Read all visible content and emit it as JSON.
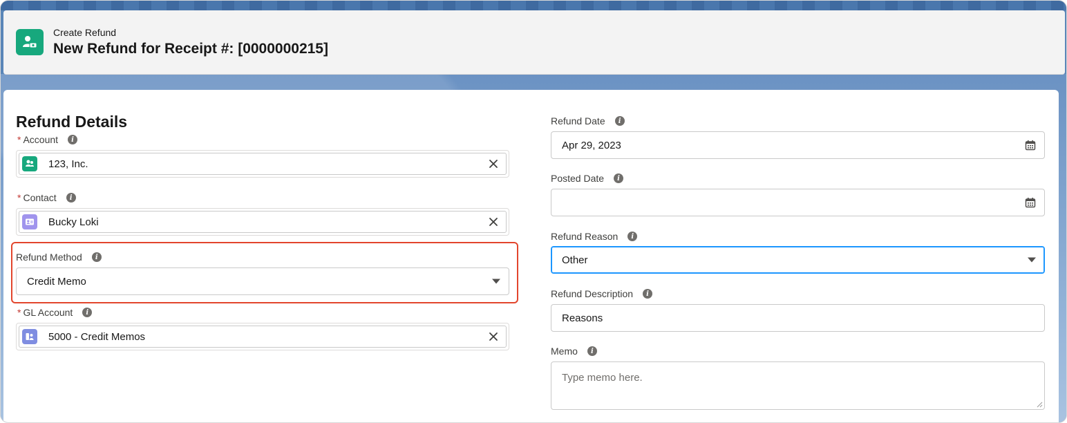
{
  "header": {
    "eyebrow": "Create Refund",
    "title": "New Refund for Receipt #: [0000000215]",
    "icon": "refund-user-icon",
    "accent": "#17a87d"
  },
  "section": {
    "title": "Refund Details"
  },
  "left": {
    "account": {
      "label": "Account",
      "required": true,
      "value": "123, Inc.",
      "icon": "account-icon",
      "icon_color": "#17a87d"
    },
    "contact": {
      "label": "Contact",
      "required": true,
      "value": "Bucky Loki",
      "icon": "contact-card-icon",
      "icon_color": "#a094ed"
    },
    "refund_method": {
      "label": "Refund Method",
      "required": false,
      "value": "Credit Memo"
    },
    "gl_account": {
      "label": "GL Account",
      "required": true,
      "value": "5000 - Credit Memos",
      "icon": "gl-account-icon",
      "icon_color": "#7f8de1"
    }
  },
  "right": {
    "refund_date": {
      "label": "Refund Date",
      "value": "Apr 29, 2023"
    },
    "posted_date": {
      "label": "Posted Date",
      "value": ""
    },
    "refund_reason": {
      "label": "Refund Reason",
      "value": "Other"
    },
    "refund_description": {
      "label": "Refund Description",
      "value": "Reasons"
    },
    "memo": {
      "label": "Memo",
      "placeholder": "Type memo here."
    }
  },
  "colors": {
    "highlight": "#e2452c",
    "focus": "#1b96ff",
    "required": "#c23934"
  },
  "required_mark": "*",
  "info_glyph": "i"
}
